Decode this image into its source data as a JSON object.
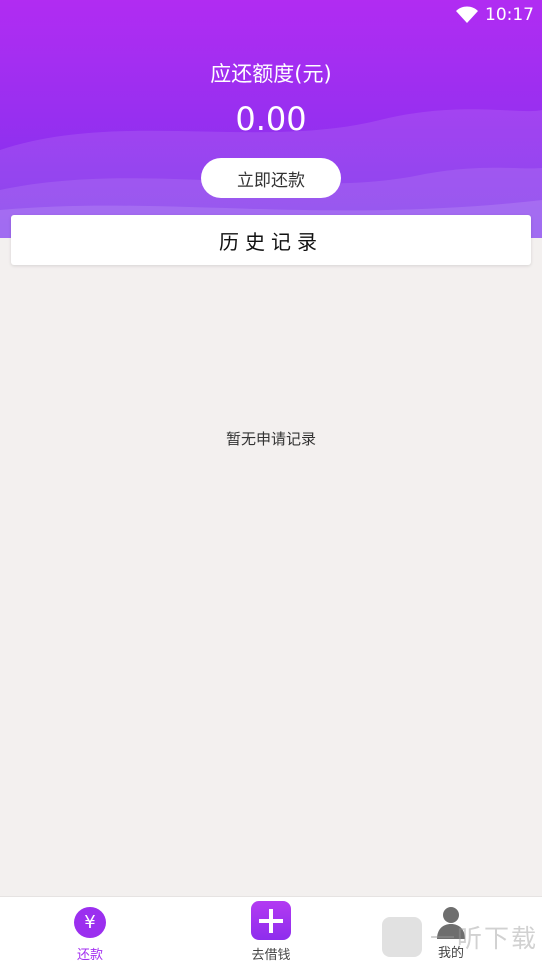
{
  "status_bar": {
    "time": "10:17"
  },
  "header": {
    "amount_label": "应还额度(元)",
    "amount_value": "0.00",
    "repay_button_label": "立即还款"
  },
  "history": {
    "title": "历史记录"
  },
  "empty_state": {
    "text": "暂无申请记录"
  },
  "bottom_nav": {
    "items": [
      {
        "label": "还款",
        "icon": "yen-icon",
        "active": true
      },
      {
        "label": "去借钱",
        "icon": "plus-icon",
        "active": false
      },
      {
        "label": "我的",
        "icon": "person-icon",
        "active": false
      }
    ]
  },
  "watermark": {
    "logo_text": "听",
    "text": "一听下载"
  },
  "colors": {
    "accent": "#9b2fef",
    "header_top": "#b12cf2",
    "header_bottom": "#7a31ec",
    "background": "#f3f0ef"
  }
}
